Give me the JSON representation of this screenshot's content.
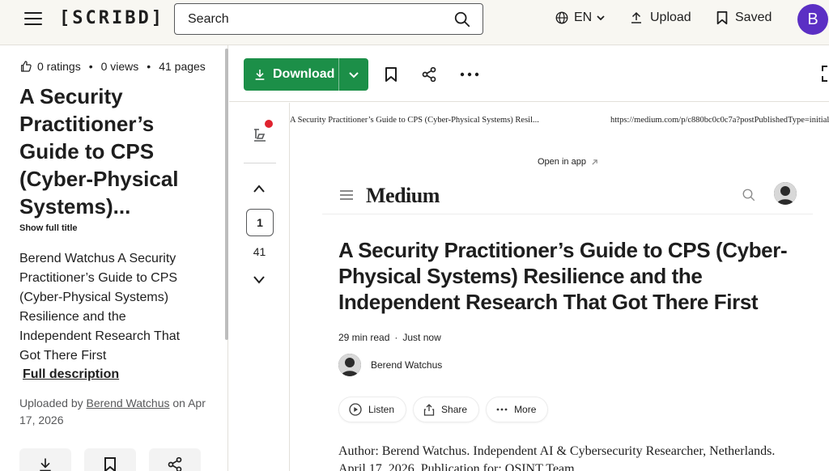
{
  "header": {
    "logo": "[SCRIBD]",
    "search_placeholder": "Search",
    "language": "EN",
    "upload_label": "Upload",
    "saved_label": "Saved",
    "avatar_initial": "B",
    "avatar_color": "#5b2fc4"
  },
  "sidebar": {
    "ratings": "0 ratings",
    "views": "0 views",
    "pages": "41 pages",
    "title_lines": [
      "A Security",
      "Practitioner’s",
      "Guide to CPS",
      "(Cyber-Physical",
      "Systems)..."
    ],
    "show_full_title": "Show full title",
    "description_lines": [
      "Berend Watchus A Security",
      "Practitioner’s Guide to CPS",
      "(Cyber-Physical Systems)",
      "Resilience and the",
      "Independent Research That",
      "Got There First"
    ],
    "full_description": "Full description",
    "uploaded_prefix": "Uploaded by ",
    "uploaded_author": "Berend Watchus",
    "uploaded_suffix": " on Apr",
    "uploaded_date_line": "17, 2026"
  },
  "toolbar": {
    "download_label": "Download",
    "download_color": "#1c8f48"
  },
  "pagenav": {
    "current_page": "1",
    "total_pages": "41"
  },
  "document": {
    "print_header_left": "A Security Practitioner’s Guide to CPS (Cyber-Physical Systems) Resil...",
    "print_header_right": "https://medium.com/p/c880bc0c0c7a?postPublishedType=initial",
    "open_in_app": "Open in app",
    "medium_logo": "Medium",
    "title_lines": [
      "A Security Practitioner’s Guide to CPS (Cyber-",
      "Physical Systems) Resilience and the",
      "Independent Research That Got There First"
    ],
    "read_time": "29 min read",
    "dot": "·",
    "published": "Just now",
    "author_name": "Berend Watchus",
    "listen_label": "Listen",
    "share_label": "Share",
    "more_label": "More",
    "body_lines": [
      "Author: Berend Watchus. Independent AI & Cybersecurity Researcher, Netherlands.",
      "April 17, 2026. Publication for: OSINT Team"
    ]
  }
}
